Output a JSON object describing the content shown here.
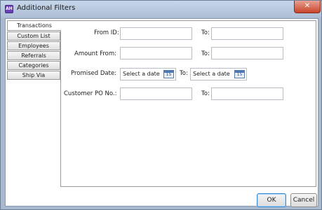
{
  "window": {
    "title": "Additional Filters",
    "icon": "app-icon",
    "close_glyph": "✕"
  },
  "tabs": [
    {
      "label": "Transactions",
      "active": true
    },
    {
      "label": "Custom List",
      "active": false
    },
    {
      "label": "Employees",
      "active": false
    },
    {
      "label": "Referrals",
      "active": false
    },
    {
      "label": "Categories",
      "active": false
    },
    {
      "label": "Ship Via",
      "active": false
    }
  ],
  "form": {
    "from_id_label": "From ID:",
    "from_id_to_label": "To:",
    "amount_from_label": "Amount From:",
    "amount_to_label": "To:",
    "promised_date_label": "Promised Date:",
    "promised_date_value": "Select a date",
    "promised_date_to_label": "To:",
    "promised_date_to_value": "Select a date",
    "calendar_day": "15",
    "customer_po_label": "Customer PO No.:",
    "customer_po_to_label": "To:"
  },
  "buttons": {
    "ok": "OK",
    "cancel": "Cancel"
  }
}
